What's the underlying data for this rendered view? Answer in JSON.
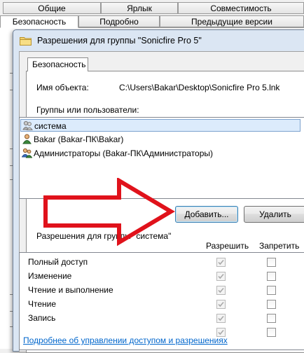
{
  "background_window": {
    "tabs_row1": [
      "Общие",
      "Ярлык",
      "Совместимость"
    ],
    "tabs_row2": [
      "Безопасность",
      "Подробно",
      "Предыдущие версии"
    ]
  },
  "dialog": {
    "title": "Разрешения для группы \"Sonicfire Pro 5\"",
    "tab": "Безопасность",
    "object_label": "Имя объекта:",
    "object_path": "C:\\Users\\Bakar\\Desktop\\Sonicfire Pro 5.lnk",
    "groups_label": "Группы или пользователи:",
    "users": [
      {
        "name": "система",
        "icon": "system-users-icon",
        "selected": true
      },
      {
        "name": "Bakar (Bakar-ПК\\Bakar)",
        "icon": "user-icon",
        "selected": false
      },
      {
        "name": "Администраторы (Bakar-ПК\\Администраторы)",
        "icon": "group-users-icon",
        "selected": false
      }
    ],
    "add_button": "Добавить...",
    "remove_button": "Удалить",
    "permissions_label": "Разрешения для группы \"система\"",
    "allow_header": "Разрешить",
    "deny_header": "Запретить",
    "permissions": [
      {
        "name": "Полный доступ",
        "allow": true,
        "deny": false
      },
      {
        "name": "Изменение",
        "allow": true,
        "deny": false
      },
      {
        "name": "Чтение и выполнение",
        "allow": true,
        "deny": false
      },
      {
        "name": "Чтение",
        "allow": true,
        "deny": false
      },
      {
        "name": "Запись",
        "allow": true,
        "deny": false
      },
      {
        "name": "",
        "allow": true,
        "deny": false
      }
    ],
    "help_link": "Подробнее об управлении доступом и разрешениях"
  },
  "colors": {
    "arrow": "#e0121b",
    "link": "#0066cc",
    "selection": "#dcebfc"
  }
}
